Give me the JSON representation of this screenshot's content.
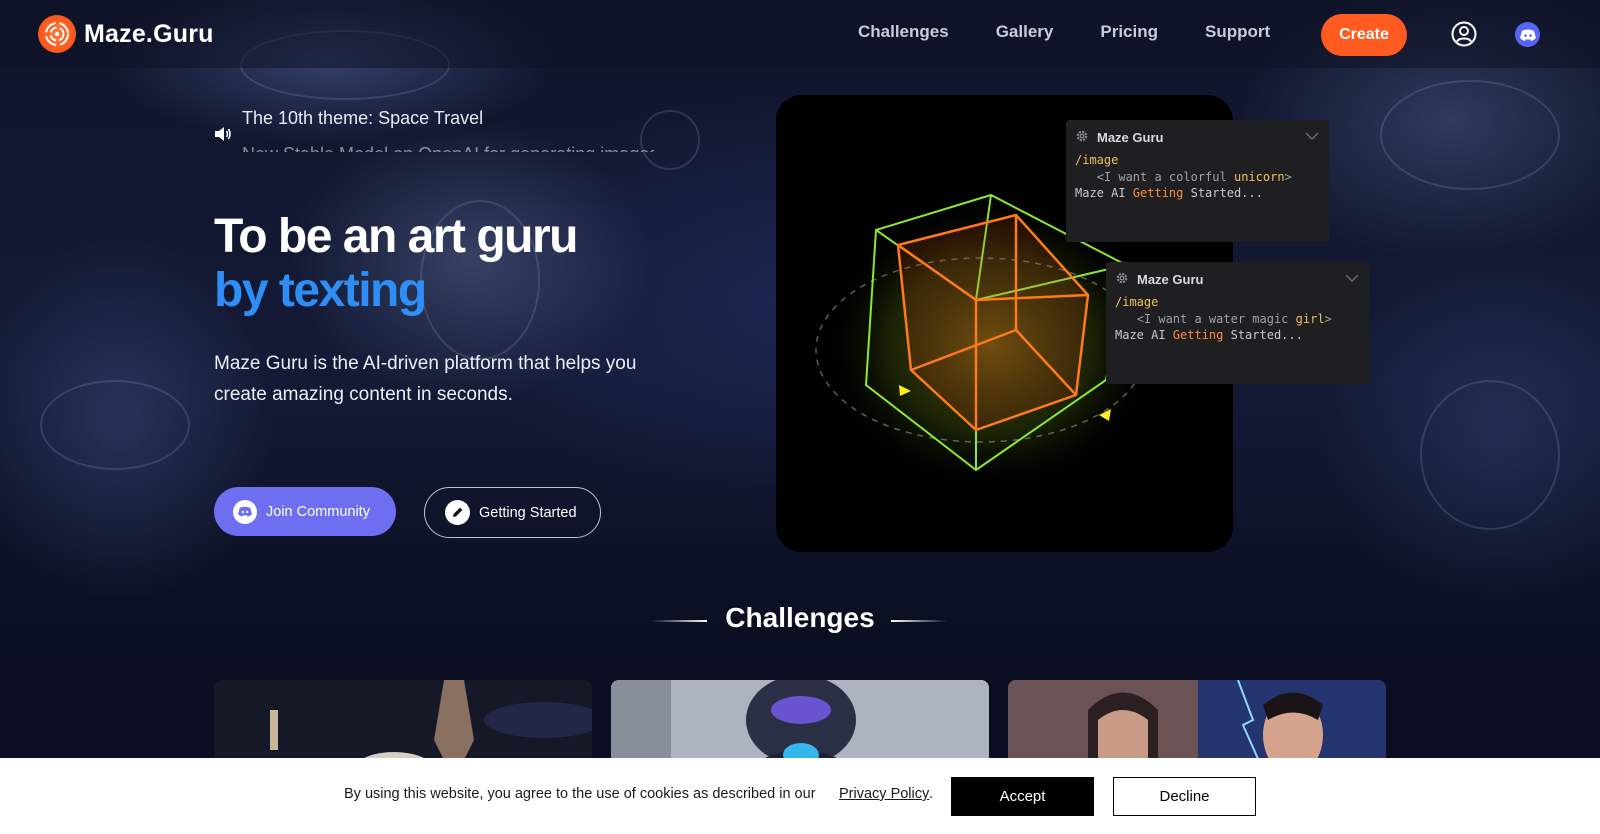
{
  "brand": {
    "name": "Maze.Guru",
    "accent": "#ff5a1f",
    "link_blue": "#2f8ef5"
  },
  "nav": {
    "links": [
      "Challenges",
      "Gallery",
      "Pricing",
      "Support"
    ],
    "create_label": "Create",
    "icons": {
      "user": "user-circle-icon",
      "discord": "discord-icon"
    }
  },
  "hero": {
    "ticker": [
      "The 10th theme: Space Travel",
      "New Stable Model on OpenAI for generating images"
    ],
    "title_line1": "To be an art guru",
    "title_line2": "by texting",
    "description": "Maze Guru is the AI-driven platform that helps you create amazing content in seconds.",
    "join_label": "Join Community",
    "start_label": "Getting Started"
  },
  "chats": [
    {
      "name": "Maze Guru",
      "command": "/image",
      "prompt_pre": "<I want a colorful ",
      "prompt_kw": "unicorn",
      "prompt_post": ">",
      "status_pre": "Maze AI ",
      "status_hl": "Getting",
      "status_post": " Started..."
    },
    {
      "name": "Maze Guru",
      "command": "/image",
      "prompt_pre": "<I want a water magic ",
      "prompt_kw": "girl",
      "prompt_post": ">",
      "status_pre": "Maze AI ",
      "status_hl": "Getting",
      "status_post": " Started..."
    }
  ],
  "challenges": {
    "title": "Challenges"
  },
  "cookie": {
    "text": "By using this website, you agree to the use of cookies as described in our",
    "link": "Privacy Policy",
    "end": ".",
    "accept": "Accept",
    "decline": "Decline"
  }
}
